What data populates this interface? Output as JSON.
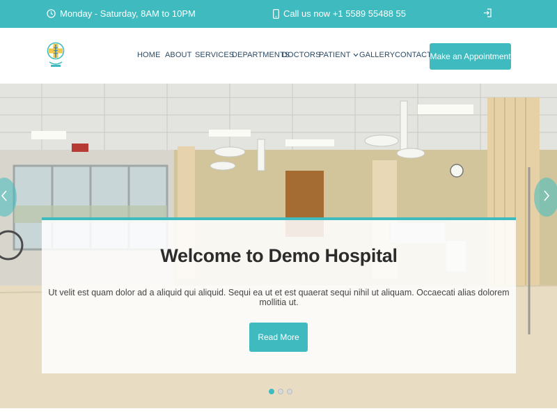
{
  "topbar": {
    "hours_icon": "clock-icon",
    "hours": "Monday - Saturday, 8AM to 10PM",
    "phone_icon": "phone-icon",
    "phone": "Call us now +1 5589 55488 55",
    "login_icon": "sign-in-icon"
  },
  "header": {
    "logo_icon": "medical-cross-logo",
    "nav": {
      "home": "HOME",
      "about": "ABOUT",
      "services": "SERVICES",
      "departments": "DEPARTMENTS",
      "doctors": "DOCTORS",
      "patient": "PATIENT",
      "gallery": "GALLERY",
      "contact": "CONTACT"
    },
    "appointment": "Make an Appointment"
  },
  "hero": {
    "title": "Welcome to Demo Hospital",
    "text": "Ut velit est quam dolor ad a aliquid qui aliquid. Sequi ea ut et est quaerat sequi nihil ut aliquam. Occaecati alias dolorem mollitia ut.",
    "button": "Read More",
    "active_slide": 1,
    "slide_count": 3
  },
  "colors": {
    "accent": "#3fbbc0",
    "nav_text": "#2c4964"
  }
}
